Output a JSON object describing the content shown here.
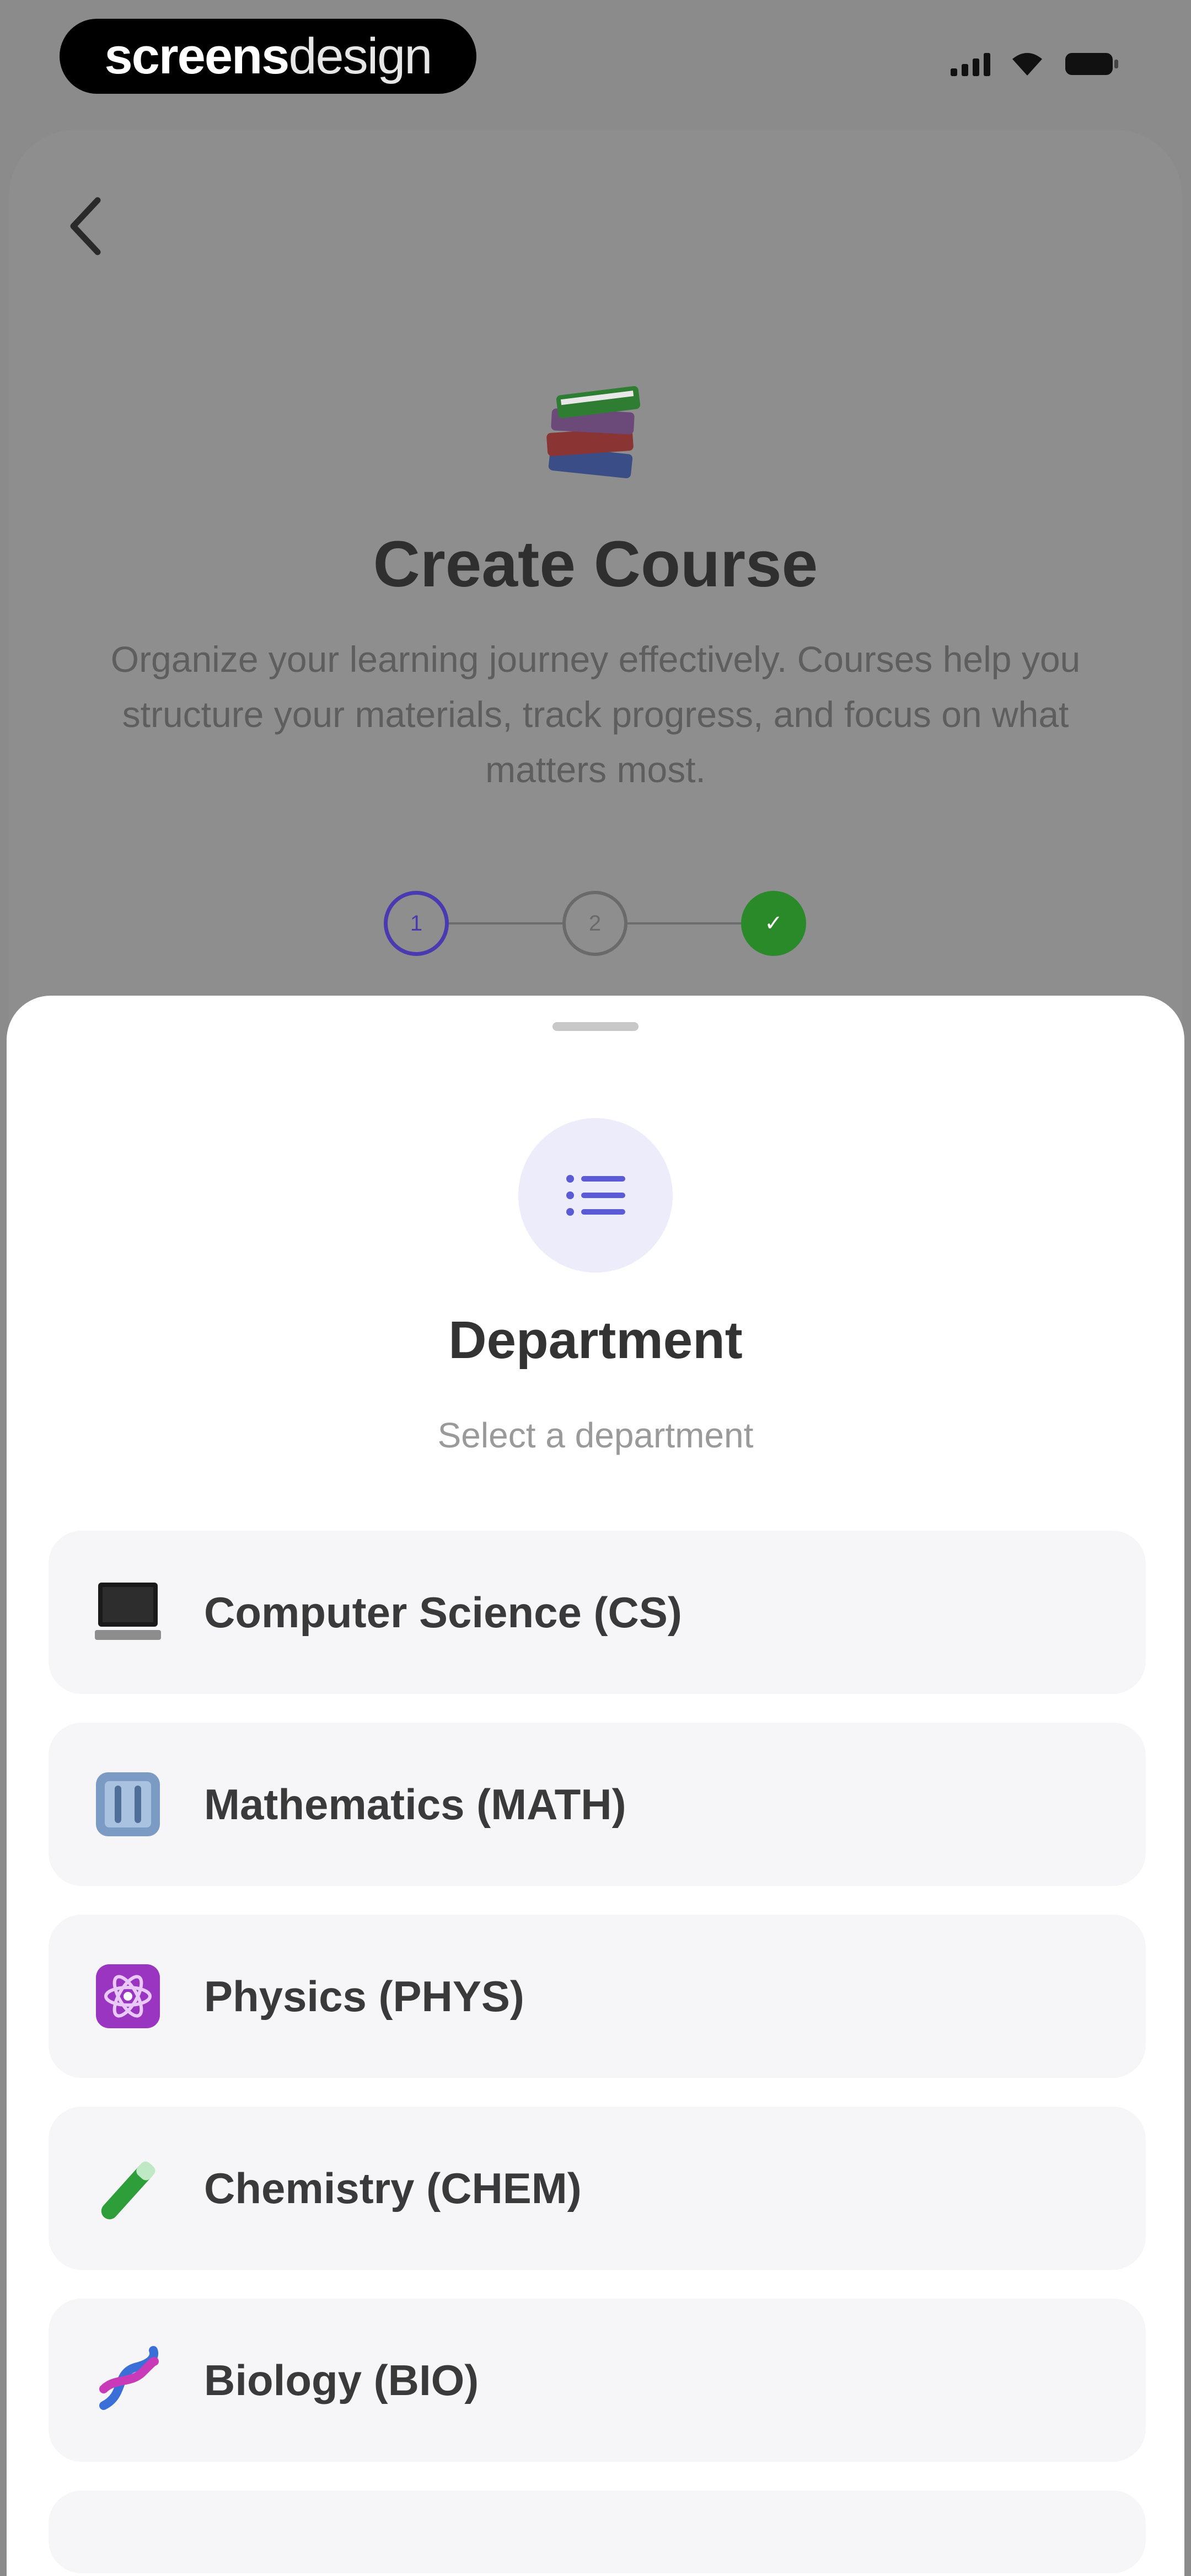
{
  "status_bar": {
    "brand_bold": "screens",
    "brand_light": "design"
  },
  "page": {
    "title": "Create Course",
    "description": "Organize your learning journey effectively. Courses help you structure your materials, track progress, and focus on what matters most.",
    "steps": [
      {
        "label": "1"
      },
      {
        "label": "2"
      },
      {
        "label": "✓"
      }
    ]
  },
  "sheet": {
    "title": "Department",
    "subtitle": "Select a department",
    "departments": [
      {
        "label": "Computer Science (CS)",
        "icon": "computer-icon"
      },
      {
        "label": "Mathematics (MATH)",
        "icon": "abacus-icon"
      },
      {
        "label": "Physics (PHYS)",
        "icon": "atom-icon"
      },
      {
        "label": "Chemistry (CHEM)",
        "icon": "test-tube-icon"
      },
      {
        "label": "Biology (BIO)",
        "icon": "dna-icon"
      }
    ]
  },
  "colors": {
    "accent": "#5b5bd6",
    "step_active": "#4a3ab0",
    "step_done": "#2a8a2a",
    "sheet_icon_bg": "#ececfb"
  }
}
